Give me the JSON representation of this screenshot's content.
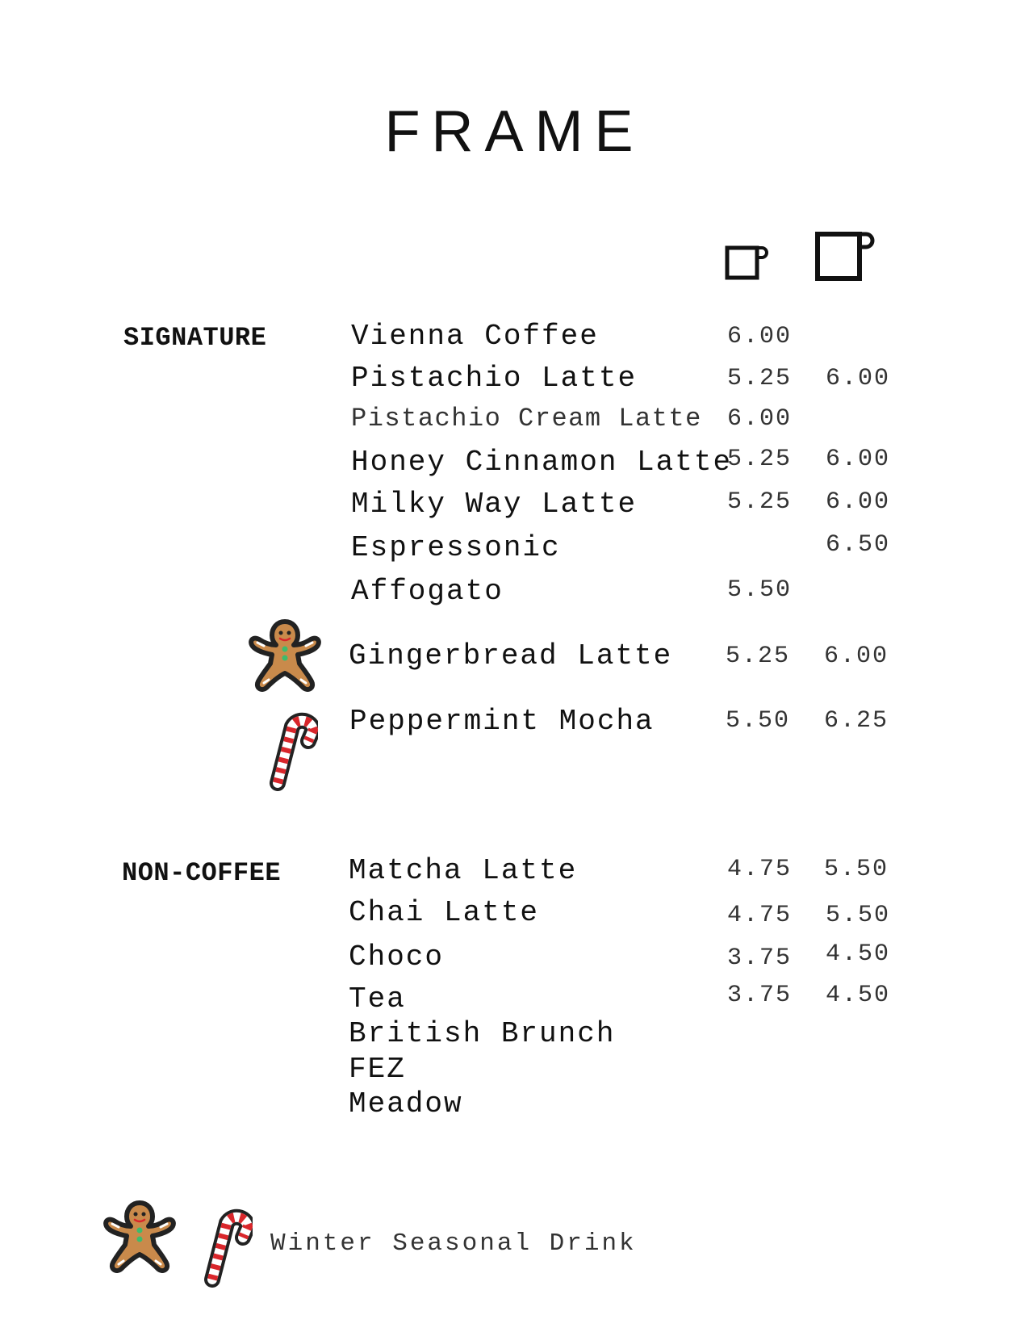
{
  "title": "FRAME",
  "size_icons": [
    "small-cup-icon",
    "large-cup-icon"
  ],
  "sections": [
    {
      "label": "SIGNATURE",
      "items": [
        {
          "name": "Vienna Coffee",
          "small": "6.00",
          "large": ""
        },
        {
          "name": "Pistachio Latte",
          "small": "5.25",
          "large": "6.00"
        },
        {
          "name": "Pistachio Cream Latte",
          "small": "6.00",
          "large": ""
        },
        {
          "name": "Honey Cinnamon Latte",
          "small": "5.25",
          "large": "6.00"
        },
        {
          "name": "Milky Way Latte",
          "small": "5.25",
          "large": "6.00"
        },
        {
          "name": "Espressonic",
          "small": "",
          "large": "6.50"
        },
        {
          "name": "Affogato",
          "small": "5.50",
          "large": ""
        },
        {
          "name": "Gingerbread Latte",
          "small": "5.25",
          "large": "6.00",
          "icon": "gingerbread-man-icon"
        },
        {
          "name": "Peppermint Mocha",
          "small": "5.50",
          "large": "6.25",
          "icon": "candy-cane-icon"
        }
      ]
    },
    {
      "label": "NON-COFFEE",
      "items": [
        {
          "name": "Matcha Latte",
          "small": "4.75",
          "large": "5.50"
        },
        {
          "name": "Chai Latte",
          "small": "4.75",
          "large": "5.50"
        },
        {
          "name": "Choco",
          "small": "3.75",
          "large": "4.50"
        },
        {
          "name": "Tea",
          "small": "3.75",
          "large": "4.50"
        },
        {
          "name": "British Brunch",
          "small": "",
          "large": ""
        },
        {
          "name": "FEZ",
          "small": "",
          "large": ""
        },
        {
          "name": "Meadow",
          "small": "",
          "large": ""
        }
      ]
    }
  ],
  "legend": {
    "icons": [
      "gingerbread-man-icon",
      "candy-cane-icon"
    ],
    "text": "Winter Seasonal Drink"
  },
  "colors": {
    "gingerbread": "#c98a4b",
    "candy_red": "#d9262b",
    "button_green": "#3dbb6c"
  }
}
